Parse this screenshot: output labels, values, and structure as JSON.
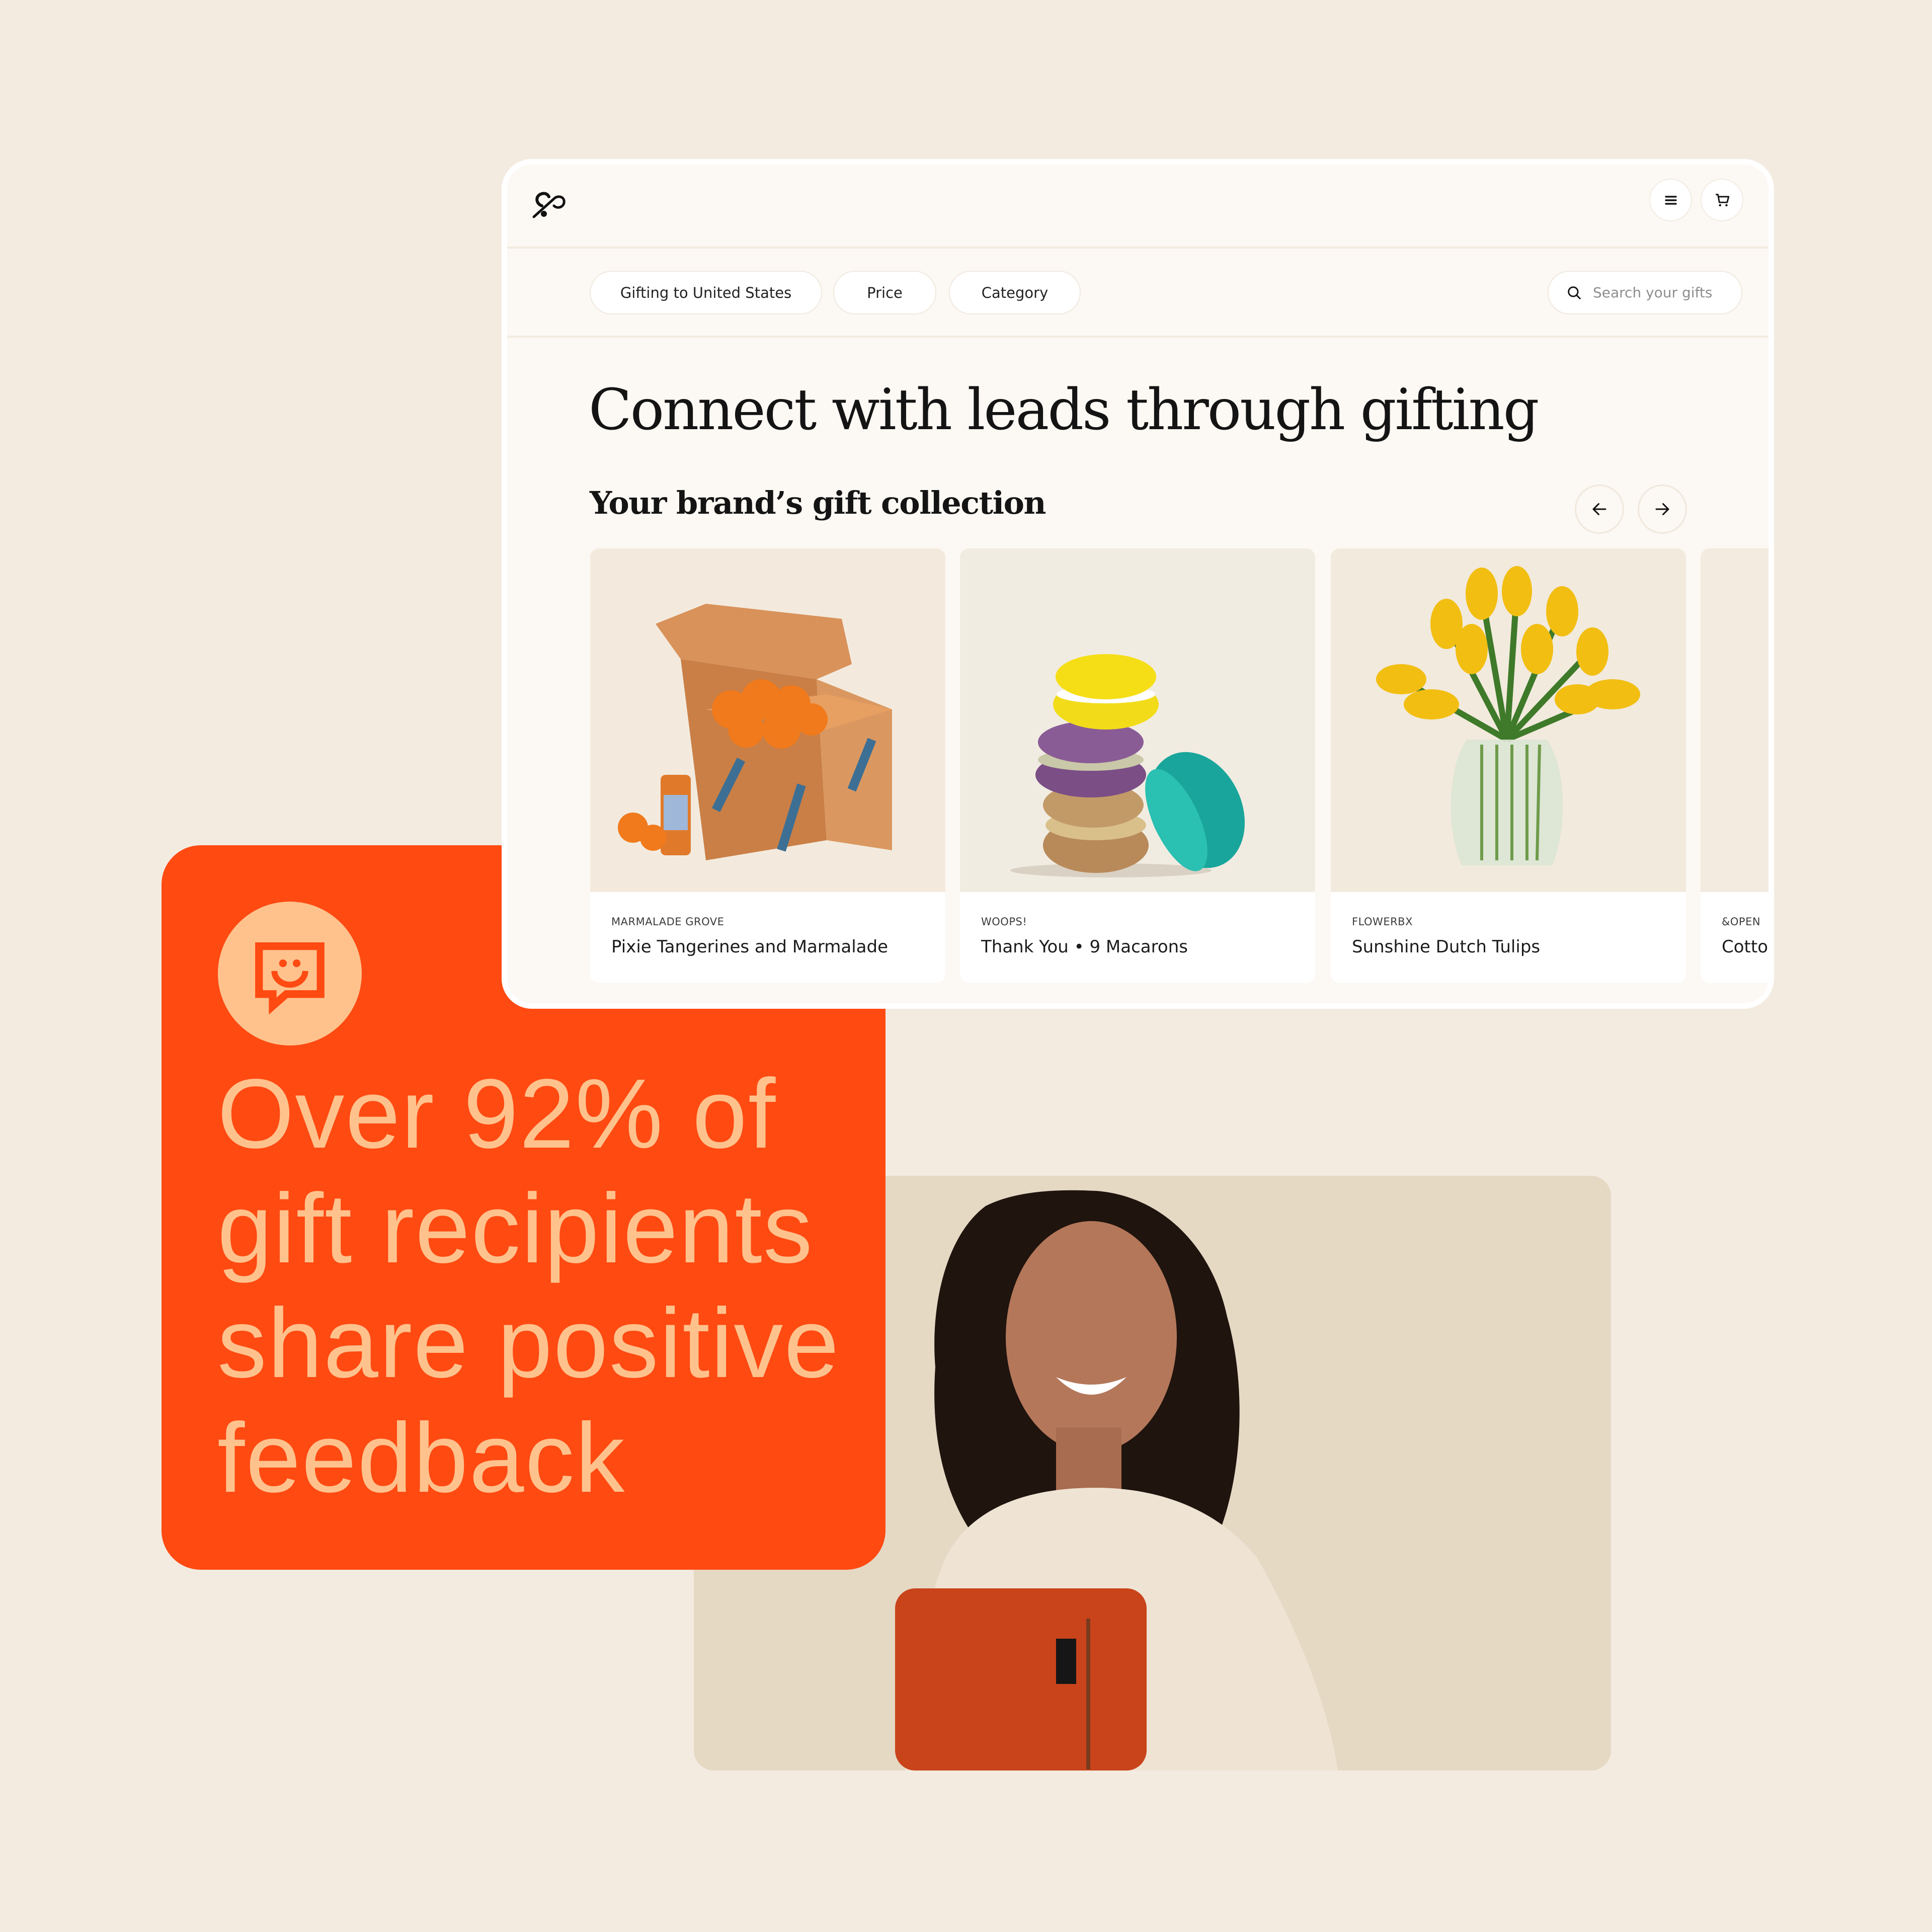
{
  "browser": {
    "logo_icon": "brand-logo-icon",
    "header_actions": [
      {
        "name": "menu",
        "icon": "hamburger-menu-icon"
      },
      {
        "name": "cart",
        "icon": "shopping-cart-icon"
      }
    ],
    "filters": [
      {
        "label": "Gifting to United States"
      },
      {
        "label": "Price"
      },
      {
        "label": "Category"
      }
    ],
    "search": {
      "placeholder": "Search your gifts",
      "value": "",
      "icon": "search-icon"
    },
    "headline": "Connect with leads through gifting",
    "collection_title": "Your brand’s gift collection",
    "carousel_controls": {
      "prev_icon": "arrow-left-icon",
      "next_icon": "arrow-right-icon"
    },
    "products": [
      {
        "brand": "MARMALADE GROVE",
        "title": "Pixie Tangerines and Marmalade"
      },
      {
        "brand": "WOOPS!",
        "title": "Thank You • 9 Macarons"
      },
      {
        "brand": "FLOWERBX",
        "title": "Sunshine Dutch Tulips"
      },
      {
        "brand": "&OPEN",
        "title": "Cotto"
      }
    ]
  },
  "stat_card": {
    "icon": "smiley-chat-bubble-icon",
    "lines": [
      "Over 92% of",
      "gift recipients",
      "share positive",
      "feedback"
    ],
    "color_bg": "#FF4A12",
    "color_text": "#FFC28D"
  },
  "colors": {
    "page_bg": "#F3EBE0",
    "browser_bg": "#FCF8F3",
    "photo_bg": "#E5D9C4"
  }
}
